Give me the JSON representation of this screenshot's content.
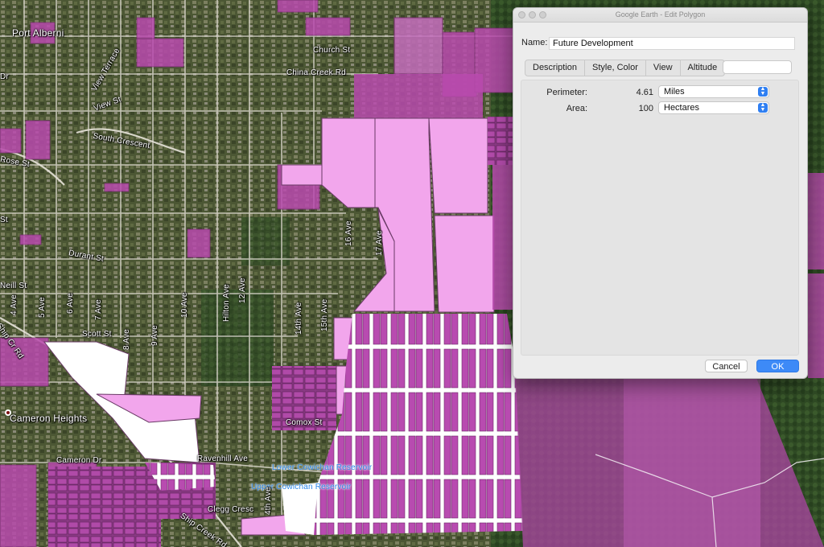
{
  "window": {
    "title": "Google Earth - Edit Polygon"
  },
  "dialog": {
    "name_label": "Name:",
    "name_value": "Future Development",
    "tabs": [
      "Description",
      "Style, Color",
      "View",
      "Altitude"
    ],
    "perimeter_label": "Perimeter:",
    "perimeter_value": "4.61",
    "perimeter_unit": "Miles",
    "area_label": "Area:",
    "area_value": "100",
    "area_unit": "Hectares",
    "cancel_label": "Cancel",
    "ok_label": "OK"
  },
  "map": {
    "labels": {
      "port_alberni": "Port Alberni",
      "church_st": "Church St",
      "china_creek": "China Creek Rd",
      "view_terrace": "View Terrace",
      "view_st": "View St",
      "south_crescent": "South Crescent",
      "rose_st": "Rose St",
      "durant_st": "Durant St",
      "neill_st": "Neill St",
      "scott_st": "Scott St",
      "cameron_heights": "Cameron Heights",
      "cameron_dr": "Cameron Dr",
      "comox_st": "Comox St",
      "ravenhill_ave": "Ravenhill Ave",
      "lower_cowichan": "Lower Cowichan Reservoir",
      "upper_cowichan": "Upper Cowichan Reservoir",
      "clegg_cresc": "Clegg Cresc",
      "ship_creek_rd": "Ship Creek Rd",
      "ship_cr_rd": "Ship Cr Rd",
      "hilton_ave": "Hilton Ave",
      "ave_17": "17 Ave",
      "ave_16": "16 Ave",
      "ave_15": "15th Ave",
      "ave_14": "14th Ave",
      "ave_12": "12 Ave",
      "ave_10": "10 Ave",
      "ave_9": "9 Ave",
      "ave_8": "8 Ave",
      "ave_7": "7 Ave",
      "ave_6": "6 Ave",
      "ave_5": "5 Ave",
      "ave_4": "4 Ave",
      "ave_4th": "4th Ave",
      "s_label": "St",
      "dr_label": "Dr"
    },
    "colors": {
      "polygon_fill": "#f2a6ec",
      "parcel_fill": "#b84bb0",
      "forest_overlay": "#a8459f",
      "dialog_accent": "#3d8af7"
    }
  }
}
